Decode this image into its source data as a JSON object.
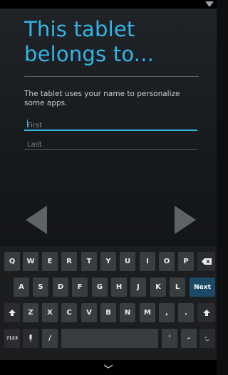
{
  "setup": {
    "title": "This tablet belongs to...",
    "description": "The tablet uses your name to personalize some apps.",
    "first_name": {
      "value": "",
      "placeholder": "First"
    },
    "last_name": {
      "value": "",
      "placeholder": "Last"
    }
  },
  "navigation": {
    "prev_icon": "left-triangle-arrow",
    "next_icon": "right-triangle-arrow"
  },
  "keyboard": {
    "row1": [
      "Q",
      "W",
      "E",
      "R",
      "T",
      "Y",
      "U",
      "I",
      "O",
      "P"
    ],
    "row2": [
      "A",
      "S",
      "D",
      "F",
      "G",
      "H",
      "J",
      "K",
      "L"
    ],
    "row3": [
      "Z",
      "X",
      "C",
      "V",
      "B",
      "N",
      "M",
      ",",
      "."
    ],
    "row4": {
      "symbols": "?123",
      "slash": "/",
      "quote": "'",
      "dash": "-"
    },
    "next_label": "Next",
    "backspace_icon": "backspace",
    "shift_icon": "shift-arrow",
    "mic_icon": "microphone"
  },
  "colors": {
    "accent": "#33b5e5",
    "background": "#16191c",
    "key": "#3a3d40",
    "next_key": "#1c4a66"
  }
}
